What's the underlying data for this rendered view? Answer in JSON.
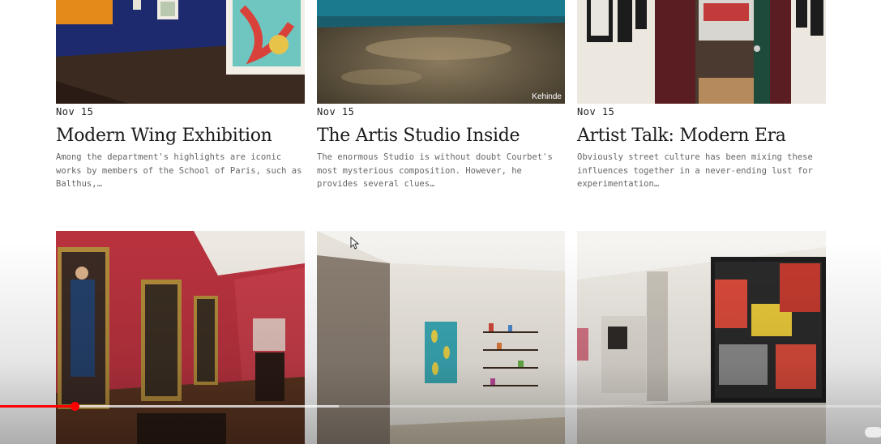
{
  "articles": [
    {
      "date": "Nov 15",
      "title": "Modern Wing Exhibition",
      "excerpt": "Among the department's highlights are iconic works by members of the School of Paris, such as Balthus,…"
    },
    {
      "date": "Nov 15",
      "title": "The Artis Studio Inside",
      "excerpt": "The enormous Studio is without doubt Courbet's most mysterious composition. However, he provides several clues…",
      "image_credit": "Kehinde"
    },
    {
      "date": "Nov 15",
      "title": "Artist Talk: Modern Era",
      "excerpt": "Obviously street culture has been mixing these influences together in a never-ending lust for experimentation…"
    }
  ],
  "video_progress": {
    "played_fraction": 0.085,
    "buffered_fraction": 0.385
  },
  "colors": {
    "progress": "#ff0000",
    "scrubber": "#ff0000"
  }
}
